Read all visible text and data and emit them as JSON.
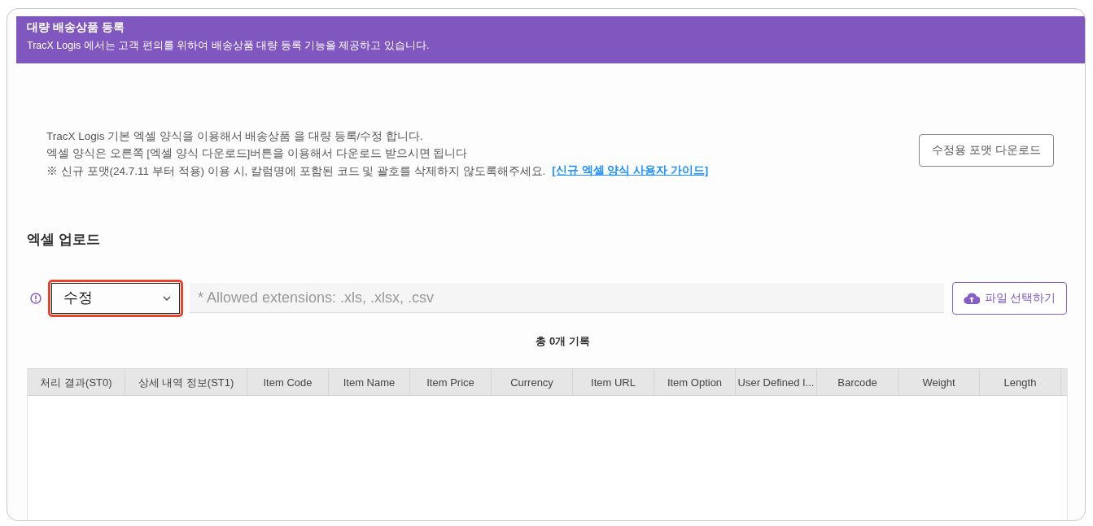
{
  "banner": {
    "title": "대량 배송상품 등록",
    "subtitle": "TracX Logis 에서는 고객 편의를 위하여 배송상품 대량 등록 기능을 제공하고 있습니다."
  },
  "description": {
    "lines": [
      "TracX Logis 기본 엑셀 양식을 이용해서 배송상품 을 대량 등록/수정 합니다.",
      "엑셀 양식은 오른쪽 [엑셀 양식 다운로드]버튼을 이용해서 다운로드 받으시면 됩니다",
      "※ 신규 포맷(24.7.11 부터 적용) 이용 시, 칼럼명에 포함된 코드 및 괄호를 삭제하지 않도록해주세요."
    ],
    "guide_link": "[신규 엑셀 양식 사용자 가이드]",
    "download_button": "수정용 포맷 다운로드"
  },
  "upload": {
    "title": "엑셀 업로드",
    "mode": "수정",
    "file_placeholder": "* Allowed extensions: .xls, .xlsx, .csv",
    "select_button": "파일 선택하기",
    "total": "총 0개 기록"
  },
  "table": {
    "columns": [
      "처리 결과(ST0)",
      "상세 내역 정보(ST1)",
      "Item Code",
      "Item Name",
      "Item Price",
      "Currency",
      "Item URL",
      "Item Option",
      "User Defined I...",
      "Barcode",
      "Weight",
      "Length"
    ]
  }
}
